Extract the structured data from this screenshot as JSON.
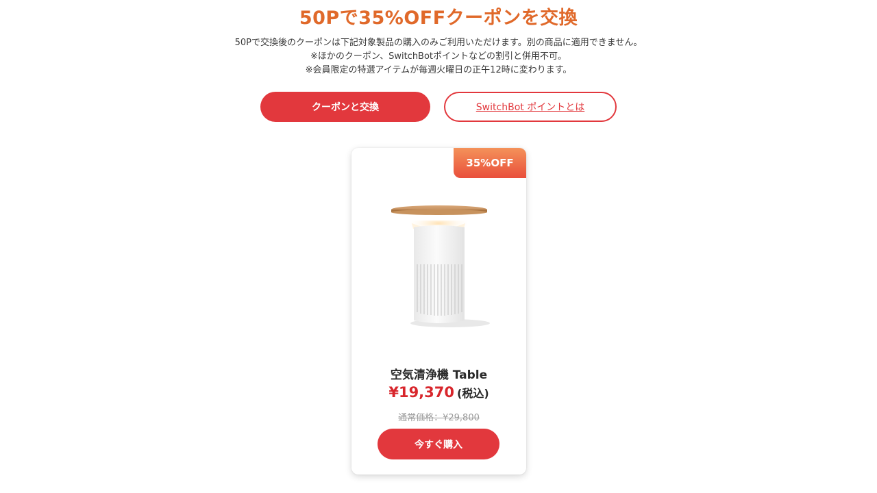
{
  "header": {
    "title": "50Pで35%OFFクーポンを交換",
    "description_lines": [
      "50Pで交換後のクーポンは下記対象製品の購入のみご利用いただけます。別の商品に適用できません。",
      "※ほかのクーポン、SwitchBotポイントなどの割引と併用不可。",
      "※会員限定の特選アイテムが毎週火曜日の正午12時に変わります。"
    ]
  },
  "actions": {
    "exchange_label": "クーポンと交換",
    "about_points_label": "SwitchBot ポイントとは"
  },
  "product": {
    "badge": "35%OFF",
    "name": "空気清浄機 Table",
    "price": "¥19,370",
    "tax_note": "(税込)",
    "regular_price": "通常価格：¥29,800",
    "buy_label": "今すぐ購入",
    "image_icon": "air-purifier-table-image"
  },
  "colors": {
    "accent_red": "#e2383d",
    "title_orange": "#e0692a",
    "price_red": "#d8262c"
  }
}
